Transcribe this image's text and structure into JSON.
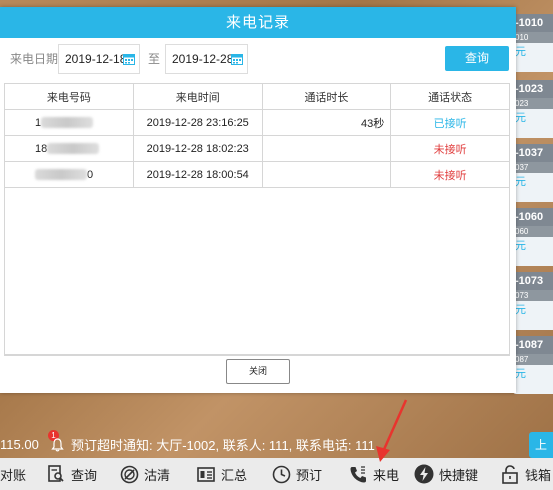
{
  "dialog": {
    "title": "来电记录",
    "filter": {
      "date_label": "来电日期",
      "start_date": "2019-12-18",
      "to_label": "至",
      "end_date": "2019-12-28",
      "query_label": "查询"
    },
    "columns": [
      "来电号码",
      "来电时间",
      "通话时长",
      "通话状态"
    ],
    "rows": [
      {
        "phone_prefix": "1",
        "phone_suffix": "",
        "time": "2019-12-28 23:16:25",
        "duration": "43秒",
        "status": "已接听",
        "status_color": "#2ab6e7"
      },
      {
        "phone_prefix": "18",
        "phone_suffix": "",
        "time": "2019-12-28 18:02:23",
        "duration": "",
        "status": "未接听",
        "status_color": "#e03c3c"
      },
      {
        "phone_prefix": "",
        "phone_suffix": "0",
        "time": "2019-12-28 18:00:54",
        "duration": "",
        "status": "未接听",
        "status_color": "#e03c3c"
      }
    ],
    "close_label": "关闭"
  },
  "background_cards": [
    {
      "num": "-1010",
      "sub": "010",
      "yuan": "元"
    },
    {
      "num": "-1023",
      "sub": "023",
      "yuan": "元"
    },
    {
      "num": "-1037",
      "sub": "037",
      "yuan": "元"
    },
    {
      "num": "-1060",
      "sub": "060",
      "yuan": "元"
    },
    {
      "num": "-1073",
      "sub": "073",
      "yuan": "元"
    },
    {
      "num": "-1087",
      "sub": "087",
      "yuan": "元"
    }
  ],
  "notification": {
    "amount": "115.00",
    "badge_count": "1",
    "message": "预订超时通知: 大厅-1002, 联系人: 111, 联系电话: 111"
  },
  "right_tab_label": "上",
  "bottom_bar": {
    "checkout_label": "对账",
    "query_label": "查询",
    "clean_label": "沽清",
    "summary_label": "汇总",
    "reserve_label": "预订",
    "incoming_label": "来电",
    "shortcut_label": "快捷键",
    "cashbox_label": "钱箱"
  },
  "colors": {
    "accent": "#2ab6e7",
    "answered": "#2ab6e7",
    "missed": "#e03c3c",
    "annotation_arrow": "#e8342e"
  }
}
